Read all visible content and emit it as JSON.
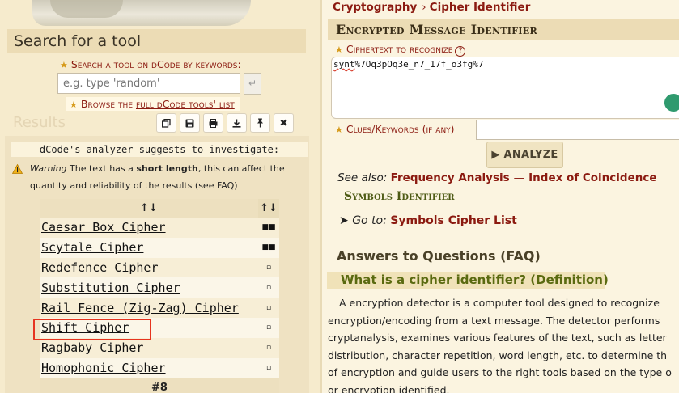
{
  "left": {
    "search_title": "Search for a tool",
    "keywords_label": "Search a tool on dCode by keywords:",
    "keywords_placeholder": "e.g. type 'random'",
    "browse_prefix": "Browse the",
    "browse_link": "full dCode tools' list",
    "results_heading": "Results",
    "toolbar_icons": [
      "copy-icon",
      "save-icon",
      "print-icon",
      "download-icon",
      "pin-icon",
      "close-icon"
    ],
    "suggest_text": "dCode's analyzer suggests to investigate:",
    "warning": {
      "lead": "Warning",
      "text_before": " The text has a ",
      "bold": "short length",
      "text_after": ", this can affect the quantity and reliability of the results (see FAQ)"
    },
    "table_header_name": "↑↓",
    "table_header_score": "↑↓",
    "results": [
      {
        "name": "Caesar Box Cipher",
        "score": "■■"
      },
      {
        "name": "Scytale Cipher",
        "score": "■■"
      },
      {
        "name": "Redefence Cipher",
        "score": "▫"
      },
      {
        "name": "Substitution Cipher",
        "score": "▫"
      },
      {
        "name": "Rail Fence (Zig-Zag) Cipher",
        "score": "▫"
      },
      {
        "name": "Shift Cipher",
        "score": "▫"
      },
      {
        "name": "Ragbaby Cipher",
        "score": "▫"
      },
      {
        "name": "Homophonic Cipher",
        "score": "▫"
      }
    ],
    "more_label": "#8"
  },
  "right": {
    "breadcrumb": [
      "Cryptography",
      "Cipher Identifier"
    ],
    "tool_title": "Encrypted Message Identifier",
    "ciphertext_label": "Ciphertext to recognize",
    "ciphertext_prefix": "synt",
    "ciphertext_rest": "%7Oq3pOq3e_n7_17f_o3fg%7",
    "clues_label": "Clues/Keywords (if any)",
    "analyze_label": "▶ ANALYZE",
    "see_also_label": "See also:",
    "see_also_links": [
      "Frequency Analysis",
      "Index of Coincidence"
    ],
    "symbols_title": "Symbols Identifier",
    "goto_label": "Go to:",
    "goto_link": "Symbols Cipher List",
    "faq_title": "Answers to Questions (FAQ)",
    "faq_question": "What is a cipher identifier? (Definition)",
    "faq_lines": [
      "A encryption detector is a computer tool designed to recognize",
      "encryption/encoding from a text message. The detector performs",
      "cryptanalysis, examines various features of the text, such as letter",
      "distribution, character repetition, word length, etc. to determine th",
      "of encryption and guide users to the right tools based on the type o",
      "or encryption identified."
    ]
  }
}
